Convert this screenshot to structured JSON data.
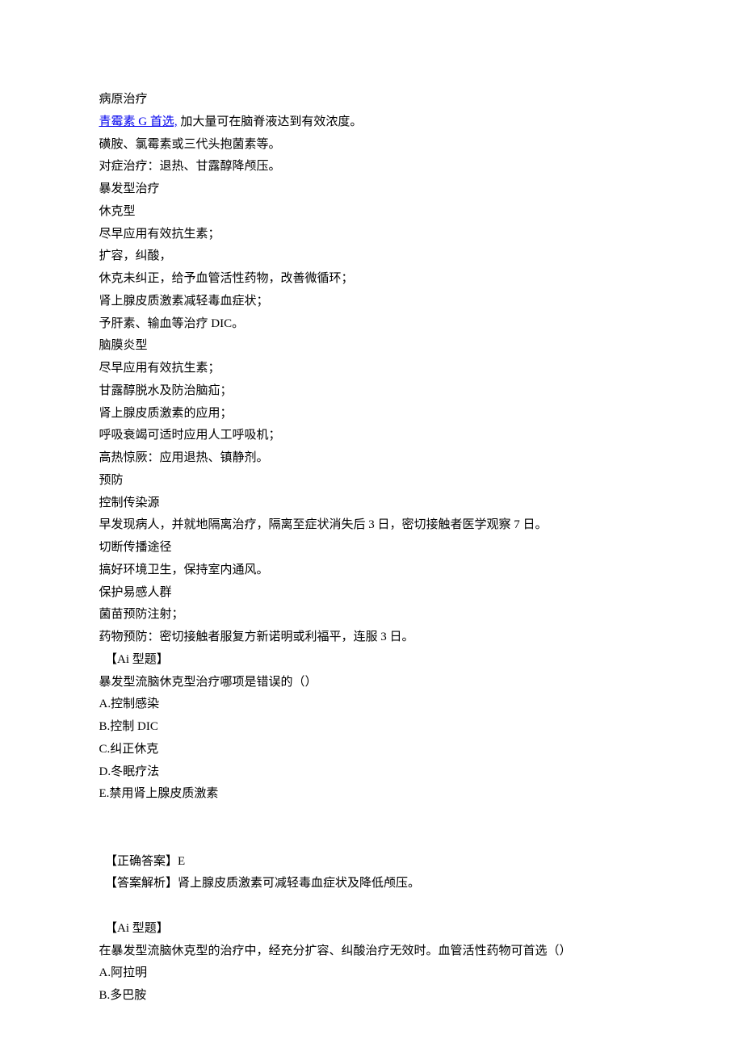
{
  "lines": [
    {
      "text": "病原治疗",
      "link": false,
      "indent": true
    },
    {
      "text": "青霉素 G 首选, 加大量可在脑脊液达到有效浓度。",
      "linkPart": "青霉素 G 首选,",
      "restPart": " 加大量可在脑脊液达到有效浓度。",
      "link": true,
      "indent": true
    },
    {
      "text": "磺胺、氯霉素或三代头抱菌素等。",
      "link": false,
      "indent": true
    },
    {
      "text": "对症治疗：退热、甘露醇降颅压。",
      "link": false,
      "indent": true
    },
    {
      "text": "暴发型治疗",
      "link": false,
      "indent": true
    },
    {
      "text": "休克型",
      "link": false,
      "indent": true
    },
    {
      "text": "尽早应用有效抗生素；",
      "link": false,
      "indent": true
    },
    {
      "text": "扩容，纠酸，",
      "link": false,
      "indent": true
    },
    {
      "text": "休克未纠正，给予血管活性药物，改善微循环；",
      "link": false,
      "indent": true
    },
    {
      "text": "肾上腺皮质激素减轻毒血症状；",
      "link": false,
      "indent": true
    },
    {
      "text": "予肝素、输血等治疗 DIC。",
      "link": false,
      "indent": true
    },
    {
      "text": "脑膜炎型",
      "link": false,
      "indent": true
    },
    {
      "text": "尽早应用有效抗生素；",
      "link": false,
      "indent": true
    },
    {
      "text": "甘露醇脱水及防治脑疝；",
      "link": false,
      "indent": true
    },
    {
      "text": "肾上腺皮质激素的应用；",
      "link": false,
      "indent": true
    },
    {
      "text": "呼吸衰竭可适时应用人工呼吸机；",
      "link": false,
      "indent": true
    },
    {
      "text": "高热惊厥：应用退热、镇静剂。",
      "link": false,
      "indent": true
    },
    {
      "text": "预防",
      "link": false,
      "indent": true
    },
    {
      "text": "控制传染源",
      "link": false,
      "indent": true
    },
    {
      "text": "早发现病人，并就地隔离治疗，隔离至症状消失后 3 日，密切接触者医学观察 7 日。",
      "link": false,
      "indent": true
    },
    {
      "text": "切断传播途径",
      "link": false,
      "indent": true
    },
    {
      "text": "搞好环境卫生，保持室内通风。",
      "link": false,
      "indent": true
    },
    {
      "text": "保护易感人群",
      "link": false,
      "indent": true
    },
    {
      "text": "菌苗预防注射；",
      "link": false,
      "indent": true
    },
    {
      "text": "药物预防：密切接触者服复方新诺明或利福平，连服 3 日。",
      "link": false,
      "indent": true
    }
  ],
  "question1": {
    "header": "【Ai 型题】",
    "stem": "暴发型流脑休克型治疗哪项是错误的（）",
    "options": {
      "A": "A.控制感染",
      "B": "B.控制 DIC",
      "C": "C.纠正休克",
      "D": "D.冬眠疗法",
      "E": "E.禁用肾上腺皮质激素"
    },
    "answerLabel": "【正确答案】E",
    "explanation": "【答案解析】肾上腺皮质激素可减轻毒血症状及降低颅压。"
  },
  "question2": {
    "header": "【Ai 型题】",
    "stem": "在暴发型流脑休克型的治疗中，经充分扩容、纠酸治疗无效时。血管活性药物可首选（）",
    "options": {
      "A": "A.阿拉明",
      "B": "B.多巴胺"
    }
  }
}
